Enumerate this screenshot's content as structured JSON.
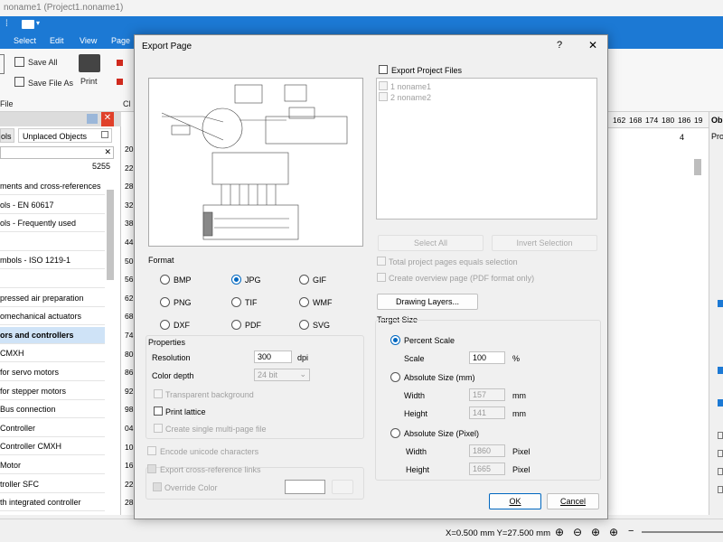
{
  "window": {
    "title": "noname1 (Project1.noname1)"
  },
  "menu": [
    "Select",
    "Edit",
    "View",
    "Page"
  ],
  "ribbon": {
    "save_all": "Save All",
    "save_file_as": "Save File As",
    "print": "Print",
    "file_group": "File",
    "cl_group": "Cl"
  },
  "left_panel": {
    "tabs": [
      "ols",
      "Unplaced Objects"
    ],
    "search_clear": "✕",
    "count": "5255",
    "items": [
      "ments and cross-references",
      "ols - EN 60617",
      "ols - Frequently used",
      "",
      "mbols - ISO 1219-1",
      "",
      "pressed air preparation",
      "omechanical actuators",
      "ors and controllers",
      " CMXH",
      " for servo motors",
      " for stepper motors",
      " Bus connection",
      " Controller",
      " Controller CMXH",
      " Motor",
      "troller SFC",
      "th integrated controller"
    ],
    "ruler_numbers": [
      "20",
      "22",
      "28",
      "32",
      "38",
      "44",
      "50",
      "56",
      "62",
      "68",
      "74",
      "80",
      "86",
      "92",
      "98",
      "04",
      "10",
      "16",
      "22",
      "28"
    ]
  },
  "top_ruler": [
    "162",
    "168",
    "174",
    "180",
    "186",
    "19"
  ],
  "page_number": "4",
  "right_panel": {
    "tab": "Ob",
    "sub": "Pro"
  },
  "status": {
    "coords": "X=0.500 mm  Y=27.500 mm"
  },
  "dialog": {
    "title": "Export Page",
    "help": "?",
    "close": "✕",
    "format_label": "Format",
    "formats": [
      {
        "label": "BMP",
        "selected": false
      },
      {
        "label": "JPG",
        "selected": true
      },
      {
        "label": "GIF",
        "selected": false
      },
      {
        "label": "PNG",
        "selected": false
      },
      {
        "label": "TIF",
        "selected": false
      },
      {
        "label": "WMF",
        "selected": false
      },
      {
        "label": "DXF",
        "selected": false
      },
      {
        "label": "PDF",
        "selected": false
      },
      {
        "label": "SVG",
        "selected": false
      }
    ],
    "properties_label": "Properties",
    "resolution_label": "Resolution",
    "resolution_value": "300",
    "resolution_unit": "dpi",
    "color_depth_label": "Color depth",
    "color_depth_value": "24 bit",
    "transparent_background": "Transparent background",
    "print_lattice": "Print lattice",
    "create_single_multi_page": "Create single multi-page file",
    "encode_unicode": "Encode unicode characters",
    "export_cross_reference": "Export cross-reference links",
    "override_color": "Override Color",
    "export_project_files": "Export Project Files",
    "project_files": [
      "1  noname1",
      "2  noname2"
    ],
    "select_all": "Select All",
    "invert_selection": "Invert Selection",
    "total_pages_equals_selection": "Total project pages equals selection",
    "create_overview_page": "Create overview page (PDF format only)",
    "drawing_layers": "Drawing Layers...",
    "target_size_label": "Target Size",
    "percent_scale": "Percent Scale",
    "scale_label": "Scale",
    "scale_value": "100",
    "scale_unit": "%",
    "absolute_size_mm": "Absolute Size (mm)",
    "width_label": "Width",
    "height_label": "Height",
    "width_mm": "157",
    "height_mm": "141",
    "mm_unit": "mm",
    "absolute_size_px": "Absolute Size (Pixel)",
    "width_px": "1860",
    "height_px": "1665",
    "px_unit": "Pixel",
    "ok": "OK",
    "cancel": "Cancel"
  },
  "colors": {
    "accent": "#1c79d4",
    "selection": "#0067c0",
    "close_red": "#e0402a"
  }
}
